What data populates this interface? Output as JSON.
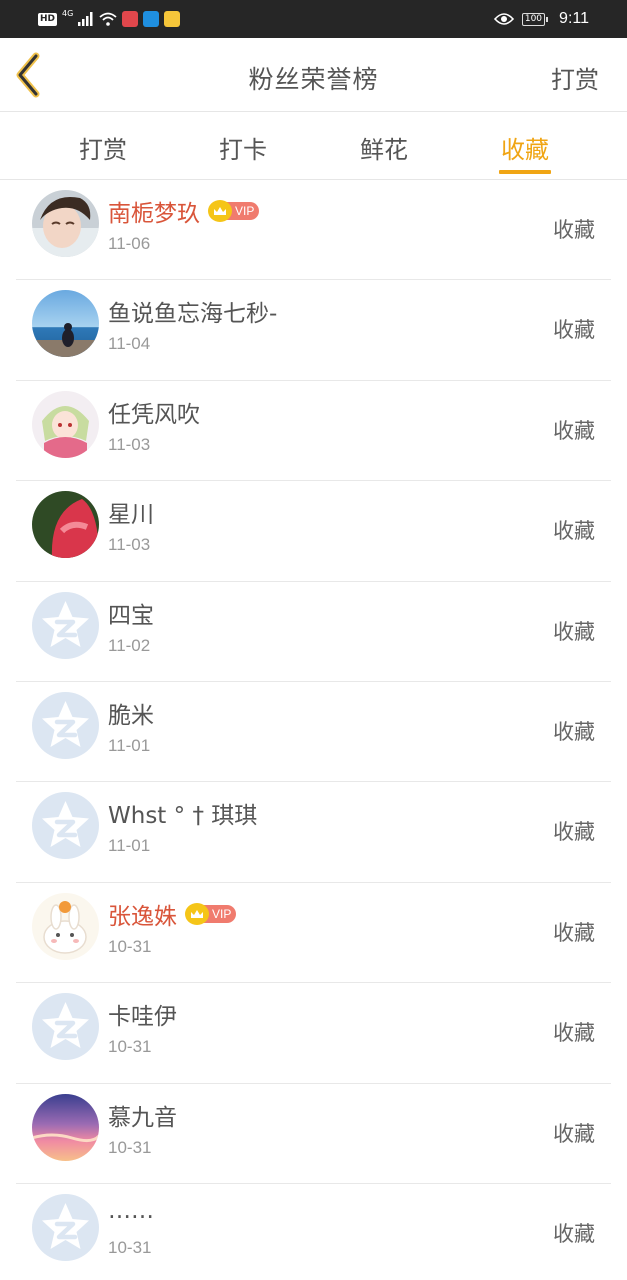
{
  "status_bar": {
    "hd": "HD",
    "network": "4G",
    "battery": "100",
    "time": "9:11",
    "icons": [
      "signal-icon",
      "wifi-icon",
      "app-notification-red-icon",
      "app-notification-blue-icon",
      "app-notification-yellow-icon",
      "eye-icon",
      "battery-icon"
    ]
  },
  "header": {
    "back_icon": "chevron-left-icon",
    "title": "粉丝荣誉榜",
    "action": "打赏"
  },
  "tabs": [
    {
      "label": "打赏",
      "active": false
    },
    {
      "label": "打卡",
      "active": false
    },
    {
      "label": "鲜花",
      "active": false
    },
    {
      "label": "收藏",
      "active": true
    }
  ],
  "colors": {
    "accent": "#f0a514",
    "vip_name": "#d9553a",
    "vip_badge": "#f07b6e",
    "text": "#555555",
    "muted": "#999999"
  },
  "vip_label": "VIP",
  "fans": [
    {
      "name": "南栀梦玖",
      "date": "11-06",
      "vip": true,
      "action": "收藏",
      "avatar": "photo-boy"
    },
    {
      "name": "鱼说鱼忘海七秒-",
      "date": "11-04",
      "vip": false,
      "action": "收藏",
      "avatar": "photo-sea"
    },
    {
      "name": "任凭风吹",
      "date": "11-03",
      "vip": false,
      "action": "收藏",
      "avatar": "photo-anime"
    },
    {
      "name": "星川",
      "date": "11-03",
      "vip": false,
      "action": "收藏",
      "avatar": "photo-red"
    },
    {
      "name": "四宝",
      "date": "11-02",
      "vip": false,
      "action": "收藏",
      "avatar": "default"
    },
    {
      "name": "脆米",
      "date": "11-01",
      "vip": false,
      "action": "收藏",
      "avatar": "default"
    },
    {
      "name": "Whst ° † 琪琪",
      "date": "11-01",
      "vip": false,
      "action": "收藏",
      "avatar": "default"
    },
    {
      "name": "张逸姝",
      "date": "10-31",
      "vip": true,
      "action": "收藏",
      "avatar": "photo-bunny"
    },
    {
      "name": "卡哇伊",
      "date": "10-31",
      "vip": false,
      "action": "收藏",
      "avatar": "default"
    },
    {
      "name": "慕九音",
      "date": "10-31",
      "vip": false,
      "action": "收藏",
      "avatar": "photo-sunset"
    },
    {
      "name": "……",
      "date": "10-31",
      "vip": false,
      "action": "收藏",
      "avatar": "default"
    }
  ]
}
